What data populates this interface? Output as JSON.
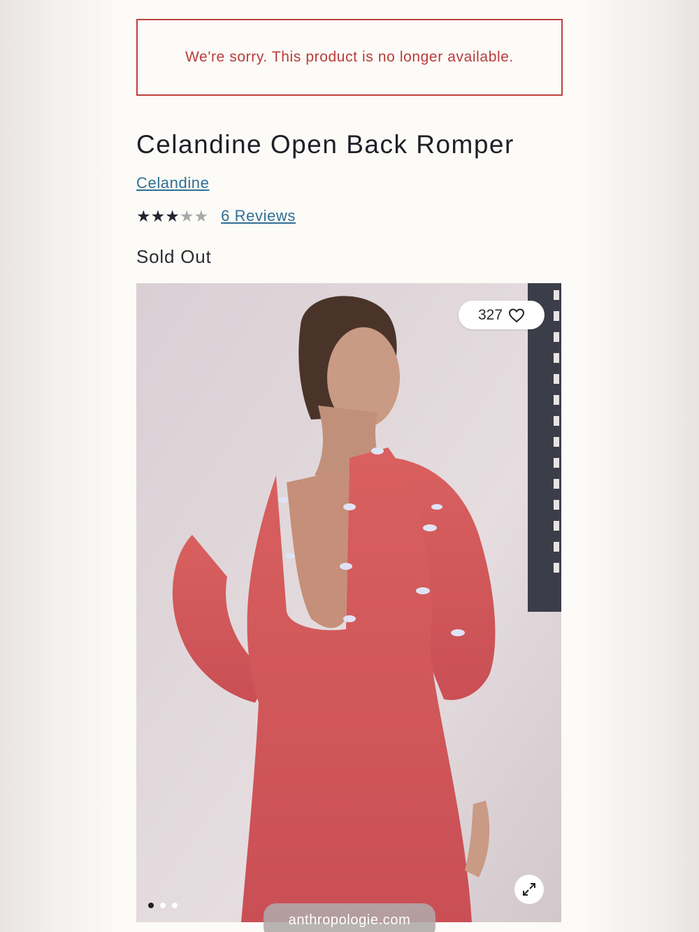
{
  "alert": {
    "message": "We're sorry. This product is no longer available."
  },
  "product": {
    "title": "Celandine Open Back Romper",
    "brand": "Celandine",
    "rating": {
      "value": 3,
      "max": 5,
      "reviews_label": "6 Reviews"
    },
    "status": "Sold Out"
  },
  "gallery": {
    "favorites_count": "327",
    "image_count": 3,
    "active_index": 0,
    "icons": {
      "favorite": "heart-outline-icon",
      "expand": "expand-arrows-icon"
    }
  },
  "browser": {
    "url": "anthropologie.com"
  },
  "colors": {
    "alert": "#b83c3a",
    "link": "#2f6f94",
    "text": "#1f1f28"
  }
}
